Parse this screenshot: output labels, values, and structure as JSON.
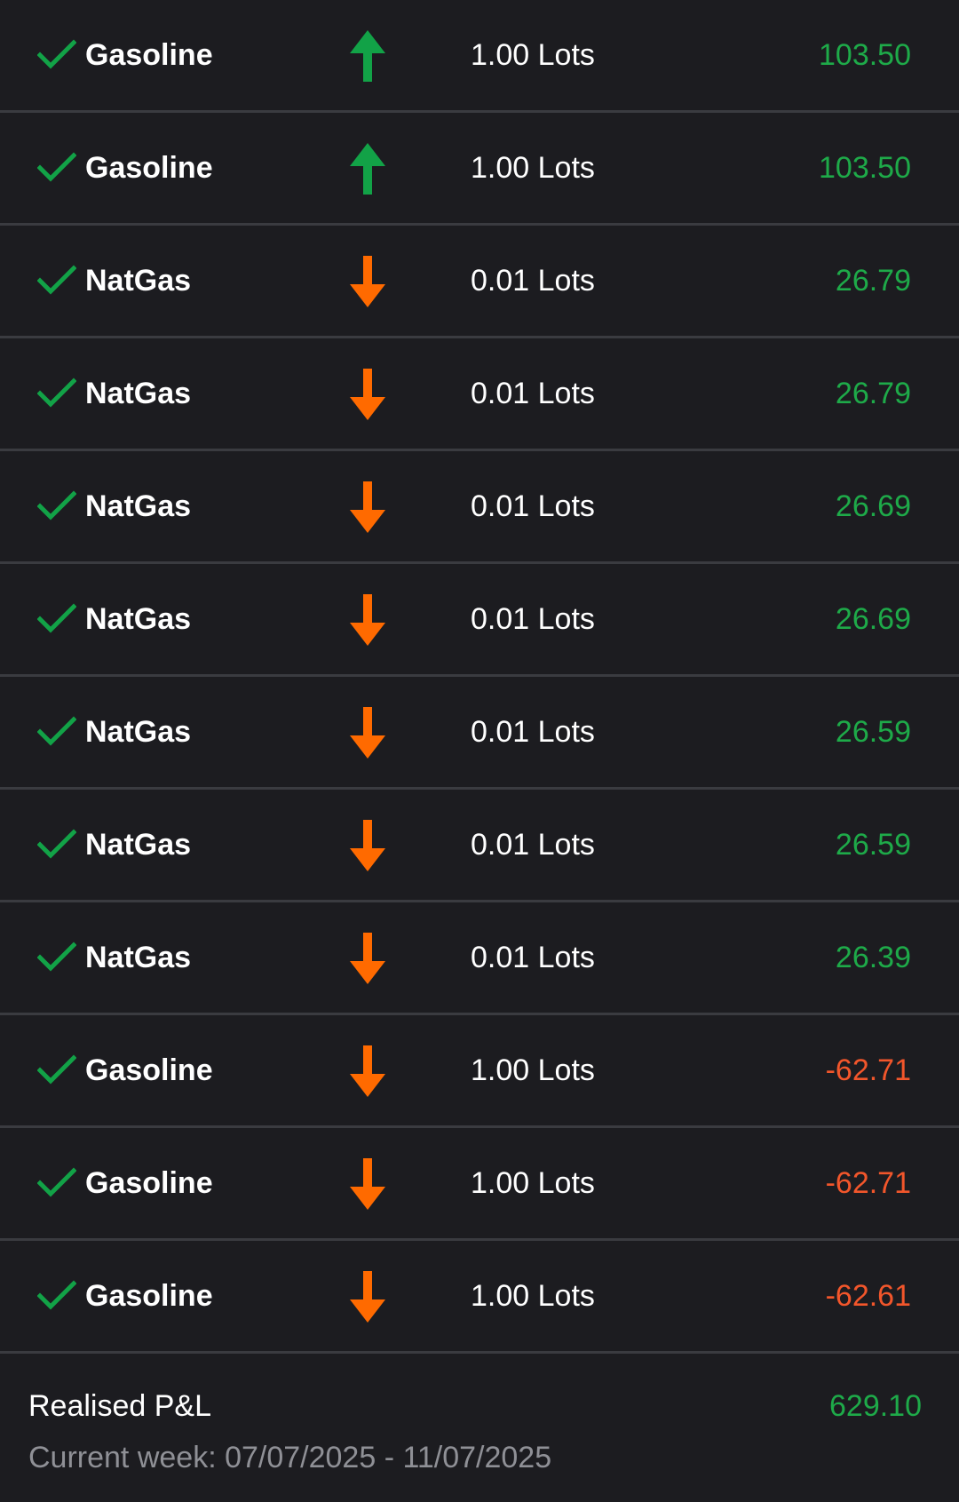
{
  "colors": {
    "background": "#1c1c20",
    "divider": "#3a3b40",
    "profit": "#1eaa49",
    "loss": "#f2562b",
    "buy_arrow": "#12a247",
    "sell_arrow": "#ff6a00",
    "check": "#12a247",
    "muted_text": "#8f9096"
  },
  "icons": {
    "status": "check-icon",
    "buy": "arrow-up-icon",
    "sell": "arrow-down-icon"
  },
  "trades": [
    {
      "symbol": "Gasoline",
      "direction": "buy",
      "volume": "1.00 Lots",
      "pnl": "103.50",
      "pnl_sign": "pos"
    },
    {
      "symbol": "Gasoline",
      "direction": "buy",
      "volume": "1.00 Lots",
      "pnl": "103.50",
      "pnl_sign": "pos"
    },
    {
      "symbol": "NatGas",
      "direction": "sell",
      "volume": "0.01 Lots",
      "pnl": "26.79",
      "pnl_sign": "pos"
    },
    {
      "symbol": "NatGas",
      "direction": "sell",
      "volume": "0.01 Lots",
      "pnl": "26.79",
      "pnl_sign": "pos"
    },
    {
      "symbol": "NatGas",
      "direction": "sell",
      "volume": "0.01 Lots",
      "pnl": "26.69",
      "pnl_sign": "pos"
    },
    {
      "symbol": "NatGas",
      "direction": "sell",
      "volume": "0.01 Lots",
      "pnl": "26.69",
      "pnl_sign": "pos"
    },
    {
      "symbol": "NatGas",
      "direction": "sell",
      "volume": "0.01 Lots",
      "pnl": "26.59",
      "pnl_sign": "pos"
    },
    {
      "symbol": "NatGas",
      "direction": "sell",
      "volume": "0.01 Lots",
      "pnl": "26.59",
      "pnl_sign": "pos"
    },
    {
      "symbol": "NatGas",
      "direction": "sell",
      "volume": "0.01 Lots",
      "pnl": "26.39",
      "pnl_sign": "pos"
    },
    {
      "symbol": "Gasoline",
      "direction": "sell",
      "volume": "1.00 Lots",
      "pnl": "-62.71",
      "pnl_sign": "neg"
    },
    {
      "symbol": "Gasoline",
      "direction": "sell",
      "volume": "1.00 Lots",
      "pnl": "-62.71",
      "pnl_sign": "neg"
    },
    {
      "symbol": "Gasoline",
      "direction": "sell",
      "volume": "1.00 Lots",
      "pnl": "-62.61",
      "pnl_sign": "neg"
    }
  ],
  "summary": {
    "label": "Realised P&L",
    "total": "629.10",
    "period": "Current week: 07/07/2025 - 11/07/2025"
  }
}
